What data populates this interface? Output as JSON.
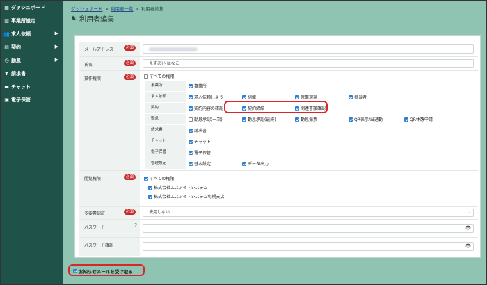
{
  "sidebar": {
    "items": [
      {
        "label": "ダッシュボード",
        "icon": "dashboard-icon",
        "arrow": ""
      },
      {
        "label": "事業所設定",
        "icon": "building-icon",
        "arrow": ""
      },
      {
        "label": "求人依頼",
        "icon": "users-icon",
        "arrow": "▶"
      },
      {
        "label": "契約",
        "icon": "document-icon",
        "arrow": "▶"
      },
      {
        "label": "勤怠",
        "icon": "clock-icon",
        "arrow": "▶"
      },
      {
        "label": "請求書",
        "icon": "yen-icon",
        "arrow": ""
      },
      {
        "label": "チャット",
        "icon": "chat-icon",
        "arrow": ""
      },
      {
        "label": "電子保管",
        "icon": "archive-icon",
        "arrow": ""
      }
    ]
  },
  "breadcrumb": {
    "items": [
      "ダッシュボード",
      "利用者一覧",
      "利用者編集"
    ],
    "sep": ">"
  },
  "page": {
    "title": "利用者編集"
  },
  "required_label": "必須",
  "form": {
    "email": {
      "label": "メールアドレス",
      "value": ""
    },
    "name": {
      "label": "氏名",
      "value": "えすあい はなこ"
    },
    "perms": {
      "label": "操作権限",
      "all_label": "すべての権限",
      "all_checked": false,
      "rows": [
        {
          "cat": "事業所",
          "opts": [
            {
              "label": "事業所",
              "checked": true
            }
          ]
        },
        {
          "cat": "求人依頼",
          "opts": [
            {
              "label": "求人依頼しよう",
              "checked": true
            },
            {
              "label": "組織",
              "checked": true
            },
            {
              "label": "就業現場",
              "checked": true
            },
            {
              "label": "担当者",
              "checked": true
            }
          ]
        },
        {
          "cat": "契約",
          "opts": [
            {
              "label": "契約内容の確認",
              "checked": true
            },
            {
              "label": "契約締結",
              "checked": true
            },
            {
              "label": "関連書類確認",
              "checked": true
            }
          ]
        },
        {
          "cat": "勤怠",
          "opts": [
            {
              "label": "勤怠承認(一次)",
              "checked": false
            },
            {
              "label": "勤怠承認(最終)",
              "checked": true
            },
            {
              "label": "勤怠振票",
              "checked": true
            },
            {
              "label": "QR表示/出退勤",
              "checked": true
            },
            {
              "label": "QR休憩申請",
              "checked": true
            }
          ]
        },
        {
          "cat": "請求書",
          "opts": [
            {
              "label": "請求書",
              "checked": true
            }
          ]
        },
        {
          "cat": "チャット",
          "opts": [
            {
              "label": "チャット",
              "checked": true
            }
          ]
        },
        {
          "cat": "電子保管",
          "opts": [
            {
              "label": "電子保管",
              "checked": true
            }
          ]
        },
        {
          "cat": "管理設定",
          "opts": [
            {
              "label": "基本設定",
              "checked": true
            },
            {
              "label": "データ出力",
              "checked": true
            }
          ]
        }
      ]
    },
    "view": {
      "label": "閲覧権限",
      "opts": [
        {
          "label": "すべての権限",
          "checked": true
        },
        {
          "label": "株式会社エスアイ・システム",
          "checked": true
        },
        {
          "label": "株式会社エスアイ・システム札幌支店",
          "checked": true
        }
      ]
    },
    "mfa": {
      "label": "多要素認証",
      "value": "使用しない",
      "arrow": "⌄"
    },
    "password": {
      "label": "パスワード",
      "help": "?",
      "eye": "👁"
    },
    "password_confirm": {
      "label": "パスワード確認",
      "eye": "👁"
    }
  },
  "notify": {
    "label": "お知らせメールを受け取る",
    "checked": true
  }
}
